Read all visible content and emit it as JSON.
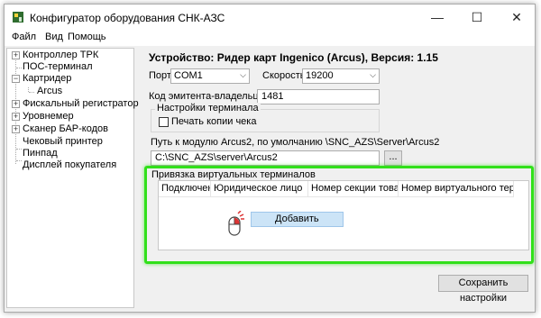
{
  "window": {
    "title": "Конфигуратор оборудования СНК-АЗС",
    "minimize": "—",
    "maximize": "☐",
    "close": "✕"
  },
  "menu": [
    "Файл",
    "Вид",
    "Помощь"
  ],
  "tree": {
    "items": [
      {
        "label": "Контроллер ТРК",
        "expander": "+"
      },
      {
        "label": "ПОС-терминал",
        "expander": ""
      },
      {
        "label": "Картридер",
        "expander": "−"
      },
      {
        "label": "Arcus",
        "expander": ""
      },
      {
        "label": "Фискальный регистратор",
        "expander": "+"
      },
      {
        "label": "Уровнемер",
        "expander": "+"
      },
      {
        "label": "Сканер БАР-кодов",
        "expander": "+"
      },
      {
        "label": "Чековый принтер",
        "expander": ""
      },
      {
        "label": "Пинпад",
        "expander": ""
      },
      {
        "label": "Дисплей покупателя",
        "expander": ""
      }
    ]
  },
  "panel": {
    "title": "Устройство: Ридер карт Ingenico (Arcus), Версия: 1.15",
    "port_label": "Порт",
    "port_value": "COM1",
    "speed_label": "Скорость",
    "speed_value": "19200",
    "issuer_label": "Код эмитента-владельца",
    "issuer_value": "1481",
    "terminal_settings_label": "Настройки терминала",
    "print_copy_label": "Печать копии чека",
    "path_label": "Путь к модулю Arcus2, по умолчанию \\SNC_AZS\\Server\\Arcus2",
    "path_value": "C:\\SNC_AZS\\server\\Arcus2",
    "browse_label": "...",
    "binding_label": "Привязка виртуальных терминалов",
    "columns": [
      "Подключен",
      "Юридическое лицо",
      "Номер секции товара",
      "Номер виртуального терми..."
    ],
    "context_add": "Добавить",
    "save_label": "Сохранить настройки"
  },
  "colors": {
    "highlight": "#31e01a",
    "selection": "#cce4f7"
  }
}
